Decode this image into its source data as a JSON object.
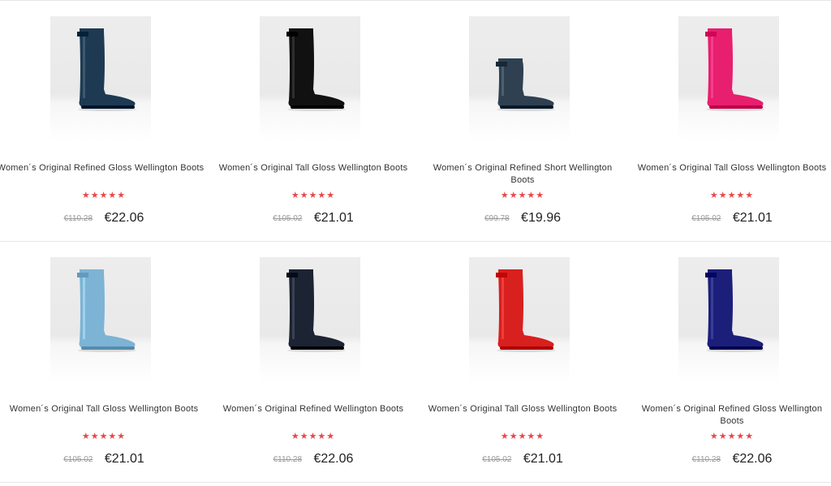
{
  "products": [
    {
      "title": "Women´s Original Refined Gloss Wellington Boots",
      "rating": "★★★★★",
      "old_price": "€110.28",
      "new_price": "€22.06",
      "boot_color": "#1e3a52",
      "boot_style": "tall"
    },
    {
      "title": "Women´s Original Tall Gloss Wellington Boots",
      "rating": "★★★★★",
      "old_price": "€105.02",
      "new_price": "€21.01",
      "boot_color": "#111111",
      "boot_style": "tall"
    },
    {
      "title": "Women´s Original Refined Short Wellington Boots",
      "rating": "★★★★★",
      "old_price": "€99.78",
      "new_price": "€19.96",
      "boot_color": "#2f4150",
      "boot_style": "short"
    },
    {
      "title": "Women´s Original Tall Gloss Wellington Boots",
      "rating": "★★★★★",
      "old_price": "€105.02",
      "new_price": "€21.01",
      "boot_color": "#e81e6e",
      "boot_style": "tall"
    },
    {
      "title": "Women´s Original Tall Gloss Wellington Boots",
      "rating": "★★★★★",
      "old_price": "€105.02",
      "new_price": "€21.01",
      "boot_color": "#7db3d4",
      "boot_style": "tall"
    },
    {
      "title": "Women´s Original Refined Wellington Boots",
      "rating": "★★★★★",
      "old_price": "€110.28",
      "new_price": "€22.06",
      "boot_color": "#1c2433",
      "boot_style": "tall"
    },
    {
      "title": "Women´s Original Tall Gloss Wellington Boots",
      "rating": "★★★★★",
      "old_price": "€105.02",
      "new_price": "€21.01",
      "boot_color": "#d8201f",
      "boot_style": "tall"
    },
    {
      "title": "Women´s Original Refined Gloss Wellington Boots",
      "rating": "★★★★★",
      "old_price": "€110.28",
      "new_price": "€22.06",
      "boot_color": "#1c1f7a",
      "boot_style": "tall"
    }
  ],
  "colors": {
    "star": "#e8474a",
    "divider": "#e6e6e6",
    "old_price": "#999999",
    "new_price": "#222222"
  }
}
